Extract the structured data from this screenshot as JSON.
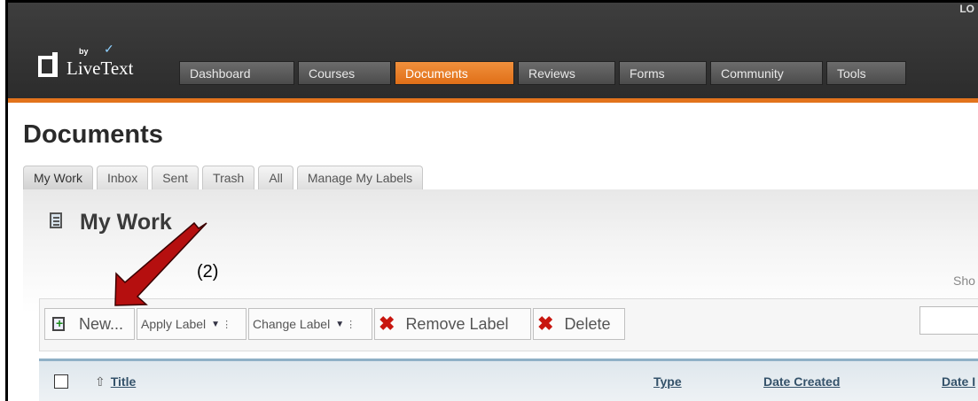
{
  "header": {
    "top_right_text": "LO",
    "logo": {
      "by": "by",
      "text": "LiveText"
    },
    "nav": [
      {
        "label": "Dashboard",
        "active": false
      },
      {
        "label": "Courses",
        "active": false
      },
      {
        "label": "Documents",
        "active": true
      },
      {
        "label": "Reviews",
        "active": false
      },
      {
        "label": "Forms",
        "active": false
      },
      {
        "label": "Community",
        "active": false
      },
      {
        "label": "Tools",
        "active": false
      }
    ]
  },
  "page": {
    "title": "Documents",
    "tabs": [
      "My Work",
      "Inbox",
      "Sent",
      "Trash",
      "All",
      "Manage My Labels"
    ],
    "active_tab": "My Work"
  },
  "section": {
    "title": "My Work",
    "show_text": "Sho"
  },
  "annotation": {
    "step_label": "(2)",
    "arrow_color": "#b50f0f"
  },
  "toolbar": {
    "new_label": "New...",
    "apply_label": "Apply Label",
    "change_label": "Change Label",
    "remove_label": "Remove Label",
    "delete_label": "Delete",
    "search_value": ""
  },
  "table": {
    "columns": [
      "Title",
      "Type",
      "Date Created",
      "Date I"
    ]
  },
  "colors": {
    "accent": "#e2731c",
    "header_bg": "#333333",
    "delete_x": "#c8160f"
  }
}
